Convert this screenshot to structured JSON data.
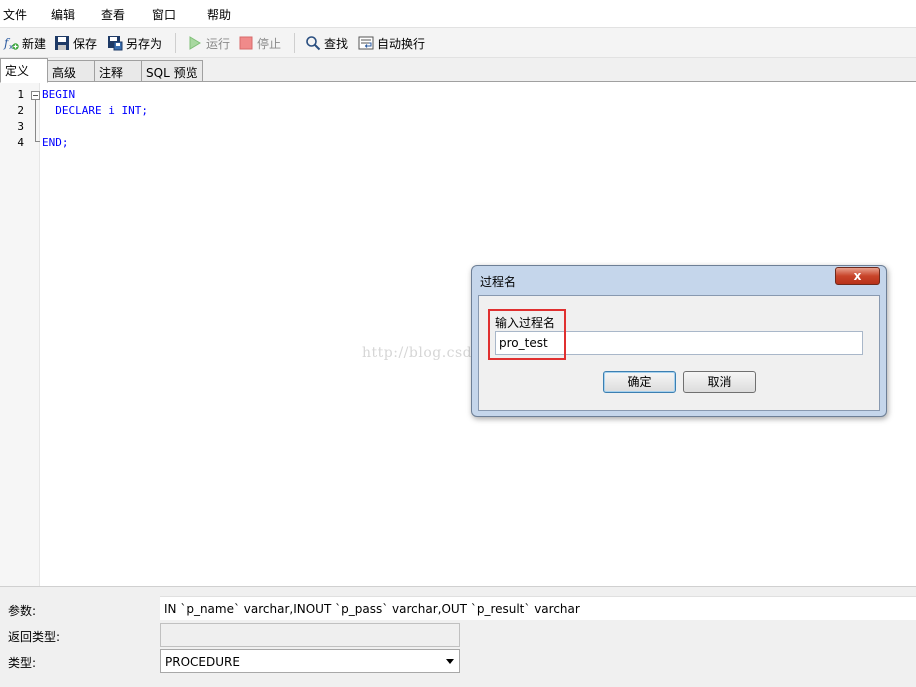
{
  "menu": [
    "文件",
    "编辑",
    "查看",
    "窗口",
    "帮助"
  ],
  "toolbar": {
    "new_label": "新建",
    "save_label": "保存",
    "save_as_label": "另存为",
    "run_label": "运行",
    "stop_label": "停止",
    "find_label": "查找",
    "wrap_label": "自动换行"
  },
  "tabs": [
    "定义",
    "高级",
    "注释",
    "SQL 预览"
  ],
  "editor": {
    "line_numbers": [
      "1",
      "2",
      "3",
      "4"
    ],
    "lines": [
      "BEGIN",
      "  DECLARE i INT;",
      "",
      "END;"
    ]
  },
  "watermark": "http://blog.csdn.net/",
  "dialog": {
    "title": "过程名",
    "close_glyph": "x",
    "label": "输入过程名",
    "input_value": "pro_test",
    "ok_label": "确定",
    "cancel_label": "取消"
  },
  "form": {
    "params_label": "参数:",
    "params_value": "IN `p_name` varchar,INOUT `p_pass` varchar,OUT `p_result` varchar",
    "return_type_label": "返回类型:",
    "return_type_value": "",
    "type_label": "类型:",
    "type_value": "PROCEDURE"
  },
  "colors": {
    "keyword": "#0000ff",
    "highlight_box": "#e03030",
    "dialog_frame": "#c5d6eb"
  }
}
